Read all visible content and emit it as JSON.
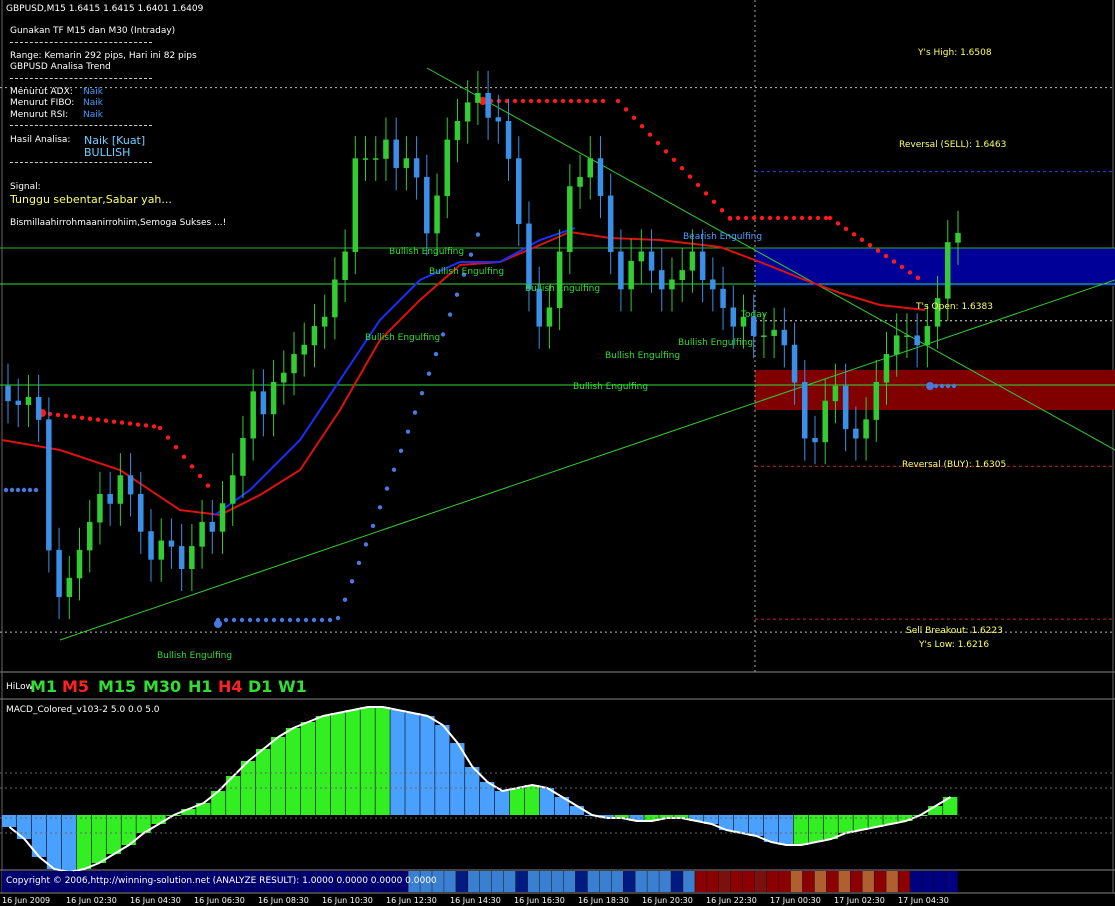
{
  "header": {
    "symbol_line": "GBPUSD,M15  1.6415 1.6415 1.6401 1.6409",
    "instruction": "Gunakan TF M15 dan M30 (Intraday)",
    "range": "Range: Kemarin 292 pips, Hari ini 82 pips",
    "analysis_title": "GBPUSD Analisa Trend"
  },
  "panel": {
    "adx_label": "Menurut ADX:",
    "adx_value": "Naik",
    "fibo_label": "Menurut FIBO:",
    "fibo_value": "Naik",
    "rsi_label": "Menurut RSI:",
    "rsi_value": "Naik",
    "result_label": "Hasil Analisa:",
    "result_value": "Naik  [Kuat]",
    "result_sub": "BULLISH",
    "signal_label": "Signal:",
    "signal_value": "Tunggu sebentar,Sabar yah...",
    "prayer": "Bismillaahirrohmaanirrohiim,Semoga Sukses ...!"
  },
  "levels": {
    "ys_high": "Y's High: 1.6508",
    "reversal_sell": "Reversal (SELL): 1.6463",
    "ts_open": "T's Open: 1.6383",
    "reversal_buy": "Reversal (BUY): 1.6305",
    "sell_breakout": "Sell Breakout: 1.6223",
    "ys_low": "Y's Low: 1.6216"
  },
  "patterns": {
    "p1": "Bullish Engulfing",
    "p2": "Bullish Engulfing",
    "p3": "Bullish Engulfing",
    "p4": "Bullish Engulfing",
    "p5": "Bearish Engulfing",
    "p6": "Bullish Engulfing",
    "p7": "Bullish Engulfing",
    "p8": "Bullish Engulfing",
    "p9": "Bullish Engulfing",
    "today": "Today"
  },
  "timeframes": {
    "label": "HiLow",
    "items": [
      {
        "label": "M1",
        "color": "#33dd33"
      },
      {
        "label": "M5",
        "color": "#ff2222"
      },
      {
        "label": "M15",
        "color": "#33dd33"
      },
      {
        "label": "M30",
        "color": "#33dd33"
      },
      {
        "label": "H1",
        "color": "#33dd33"
      },
      {
        "label": "H4",
        "color": "#ff2222"
      },
      {
        "label": "D1",
        "color": "#33dd33"
      },
      {
        "label": "W1",
        "color": "#33dd33"
      }
    ]
  },
  "macd": {
    "title": "MACD_Colored_v103-2 5.0 0.0 5.0"
  },
  "footer": {
    "copyright": "Copyright © 2006,http://winning-solution.net (ANALYZE RESULT): 1.0000 0.0000 0.0000 0.0000"
  },
  "time_axis": {
    "labels": [
      "16 Jun 2009",
      "16 Jun 02:30",
      "16 Jun 04:30",
      "16 Jun 06:30",
      "16 Jun 08:30",
      "16 Jun 10:30",
      "16 Jun 12:30",
      "16 Jun 14:30",
      "16 Jun 16:30",
      "16 Jun 18:30",
      "16 Jun 20:30",
      "16 Jun 22:30",
      "17 Jun 00:30",
      "17 Jun 02:30",
      "17 Jun 04:30"
    ]
  },
  "colors": {
    "bull_candle": "#33cc33",
    "bear_candle": "#3b8fe6",
    "resistance_zone": "#000099",
    "support_zone": "#800000",
    "ma_red": "#dd1111",
    "ma_blue": "#1a2fff",
    "sar_red": "#ff1a1a",
    "sar_blue": "#4a78e0",
    "macd_up": "#33ee22",
    "macd_down": "#4aa0ff"
  },
  "chart_data": {
    "type": "candlestick",
    "symbol": "GBPUSD",
    "timeframe": "M15",
    "ohlc_last": {
      "open": 1.6415,
      "high": 1.6415,
      "low": 1.6401,
      "close": 1.6409
    },
    "levels": {
      "ys_high": 1.6508,
      "reversal_sell": 1.6463,
      "ts_open": 1.6383,
      "reversal_buy": 1.6305,
      "sell_breakout": 1.6223,
      "ys_low": 1.6216
    },
    "x_ticks": [
      "16 Jun 2009",
      "16 Jun 02:30",
      "16 Jun 04:30",
      "16 Jun 06:30",
      "16 Jun 08:30",
      "16 Jun 10:30",
      "16 Jun 12:30",
      "16 Jun 14:30",
      "16 Jun 16:30",
      "16 Jun 18:30",
      "16 Jun 20:30",
      "16 Jun 22:30",
      "17 Jun 00:30",
      "17 Jun 02:30",
      "17 Jun 04:30"
    ],
    "close_series": [
      1.634,
      1.6338,
      1.6342,
      1.633,
      1.626,
      1.6235,
      1.6245,
      1.626,
      1.6275,
      1.629,
      1.6285,
      1.63,
      1.629,
      1.627,
      1.6255,
      1.6265,
      1.6262,
      1.625,
      1.6262,
      1.6275,
      1.627,
      1.6285,
      1.63,
      1.632,
      1.6345,
      1.6333,
      1.635,
      1.6355,
      1.6365,
      1.637,
      1.638,
      1.6385,
      1.6405,
      1.642,
      1.647,
      1.647,
      1.647,
      1.648,
      1.6465,
      1.647,
      1.646,
      1.643,
      1.645,
      1.648,
      1.649,
      1.65,
      1.6505,
      1.6492,
      1.649,
      1.647,
      1.6435,
      1.64,
      1.638,
      1.639,
      1.642,
      1.6455,
      1.646,
      1.647,
      1.645,
      1.642,
      1.64,
      1.6415,
      1.642,
      1.641,
      1.64,
      1.6405,
      1.641,
      1.642,
      1.6405,
      1.64,
      1.639,
      1.638,
      1.6385,
      1.6375,
      1.6375,
      1.6378,
      1.637,
      1.635,
      1.632,
      1.6318,
      1.634,
      1.6348,
      1.6325,
      1.632,
      1.633,
      1.635,
      1.6365,
      1.6375,
      1.6375,
      1.637,
      1.638,
      1.6395,
      1.6425,
      1.643
    ],
    "macd_values": [
      -0.4,
      -0.8,
      -1.4,
      -1.8,
      -1.9,
      -1.8,
      -1.6,
      -1.3,
      -1.0,
      -0.6,
      -0.3,
      0.0,
      0.2,
      0.4,
      0.8,
      1.3,
      1.8,
      2.2,
      2.6,
      2.9,
      3.1,
      3.3,
      3.4,
      3.5,
      3.6,
      3.6,
      3.5,
      3.4,
      3.3,
      3.0,
      2.4,
      1.6,
      1.1,
      0.8,
      0.9,
      1.0,
      0.9,
      0.6,
      0.3,
      0.0,
      -0.1,
      -0.1,
      -0.2,
      -0.2,
      -0.1,
      -0.1,
      -0.2,
      -0.3,
      -0.5,
      -0.6,
      -0.7,
      -0.9,
      -1.0,
      -1.0,
      -0.9,
      -0.8,
      -0.6,
      -0.5,
      -0.4,
      -0.3,
      -0.2,
      0.0,
      0.3,
      0.6
    ]
  }
}
